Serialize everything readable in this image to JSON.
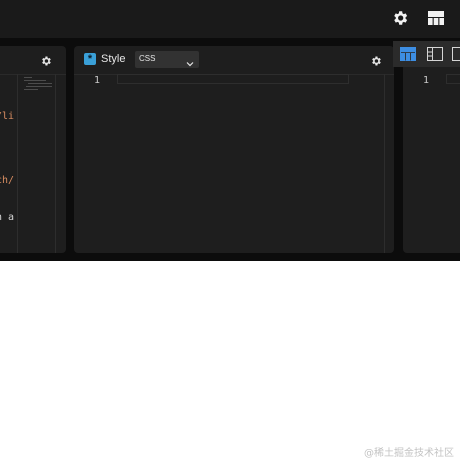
{
  "colors": {
    "topbar_bg": "#1a1a1a",
    "panel_bg": "#1e1e1e",
    "accent_blue": "#3aa0d8",
    "active_layout": "#3d8ee3",
    "code_orange": "#d98e62"
  },
  "topbar": {
    "settings_icon": "gear-icon",
    "layout_icon": "grid-layout-icon"
  },
  "left_panel": {
    "gear_icon": "gear-icon",
    "code_fragments": [
      "x/li",
      "rch/",
      "In a"
    ]
  },
  "style_panel": {
    "badge_glyph": "*",
    "title": "Style",
    "language_select": {
      "value": "CSS",
      "icon": "chevron-down-icon"
    },
    "gear_icon": "gear-icon",
    "line_numbers": [
      "1"
    ]
  },
  "right_panel": {
    "line_numbers": [
      "1"
    ]
  },
  "layout_toolbar": {
    "buttons": [
      {
        "icon": "layout-top-icon",
        "active": true
      },
      {
        "icon": "layout-left-icon",
        "active": false
      },
      {
        "icon": "layout-right-icon",
        "active": false
      }
    ]
  },
  "watermark": "@稀土掘金技术社区"
}
